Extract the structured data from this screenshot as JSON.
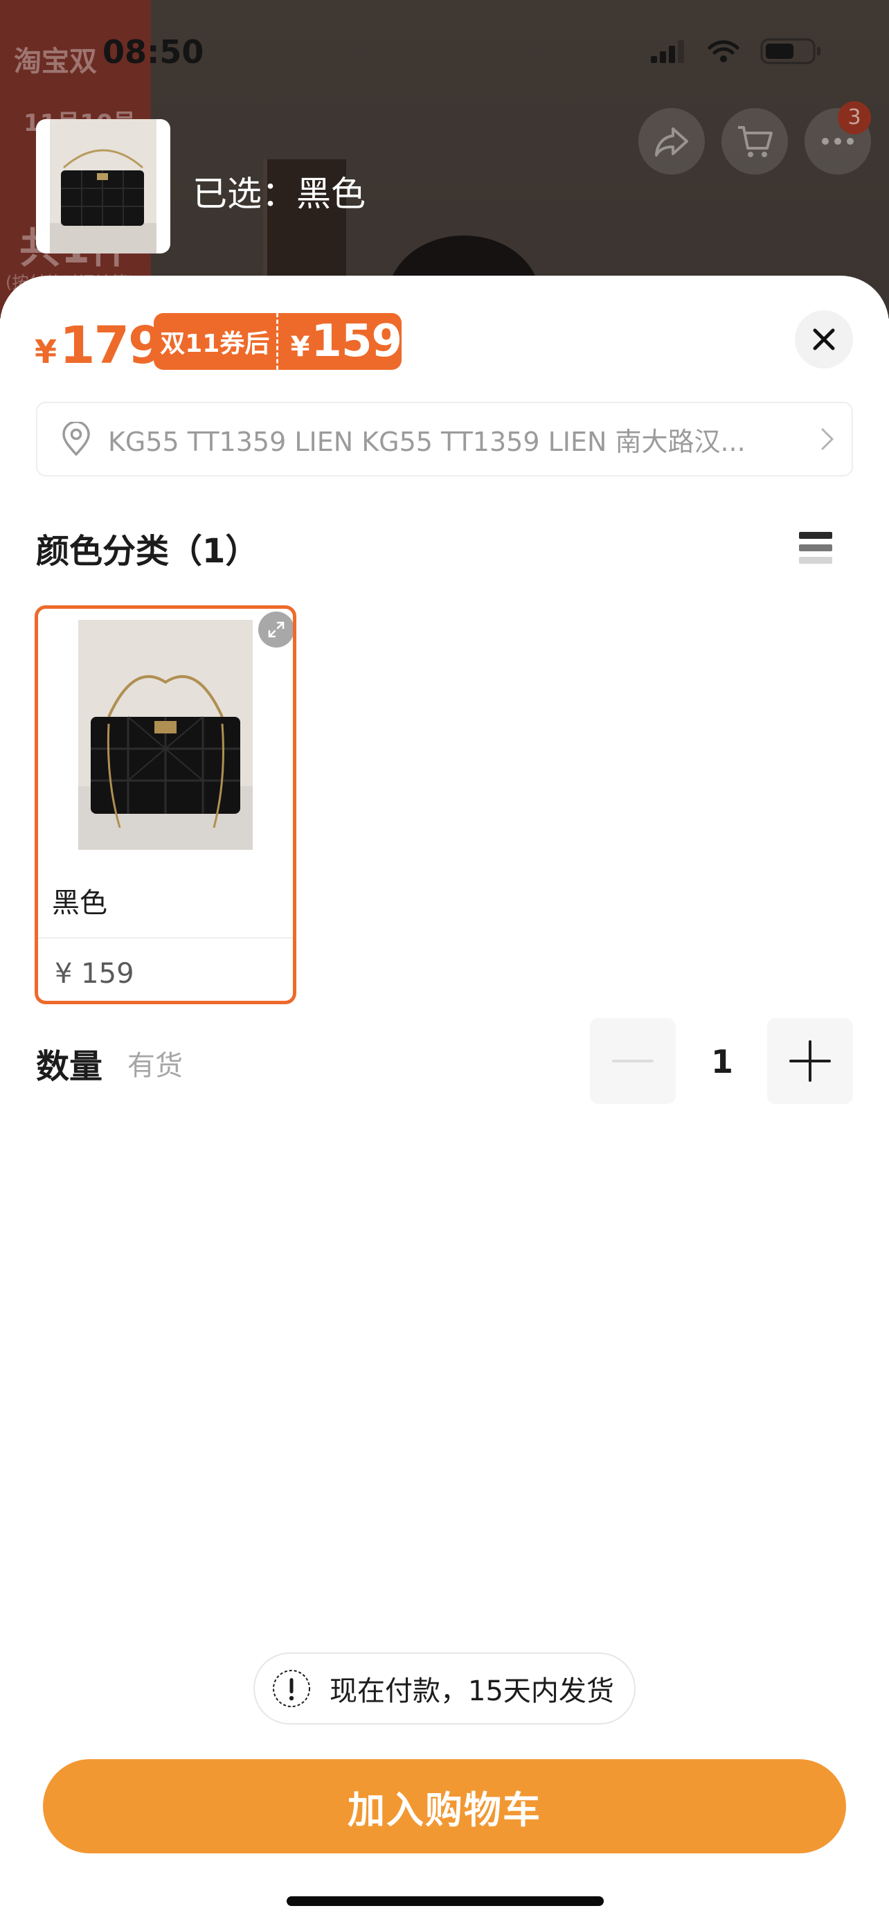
{
  "status_bar": {
    "time": "08:50"
  },
  "background": {
    "logo_text": "淘宝双",
    "date_text": "11月10号",
    "big_text": "共1件",
    "small_text": "(按付款时间计算)",
    "cart_badge": "3"
  },
  "selected": {
    "label": "已选：黑色"
  },
  "price": {
    "symbol": "¥",
    "value": "179"
  },
  "coupon": {
    "tag": "双11券后",
    "symbol": "¥",
    "value": "159"
  },
  "address": {
    "text": "KG55 TT1359 LIEN KG55 TT1359 LIEN 南大路汉..."
  },
  "color_section": {
    "title": "颜色分类（1）"
  },
  "sku": {
    "name": "黑色",
    "price": "¥ 159"
  },
  "quantity": {
    "label": "数量",
    "stock": "有货",
    "value": "1"
  },
  "notice": {
    "text": "现在付款，15天内发货"
  },
  "cart_button": {
    "label": "加入购物车"
  },
  "colors": {
    "accent": "#ee6a2a",
    "button": "#f29832"
  }
}
